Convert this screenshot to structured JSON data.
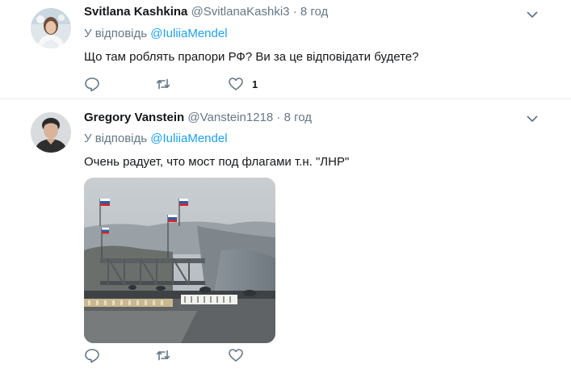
{
  "tweets": [
    {
      "fullname": "Svitlana Kashkina",
      "handle": "@SvitlanaKashki3",
      "separator": "·",
      "time": "8 год",
      "reply_prefix": "У відповідь",
      "reply_mention": "@IuliiaMendel",
      "text": "Що там роблять прапори РФ? Ви за це відповідати будете?",
      "like_count": "1",
      "icons": [
        "reply-icon",
        "retweet-icon",
        "heart-icon",
        "chevron-down-icon"
      ]
    },
    {
      "fullname": "Gregory Vanstein",
      "handle": "@Vanstein1218",
      "separator": "·",
      "time": "8 год",
      "reply_prefix": "У відповідь",
      "reply_mention": "@IuliiaMendel",
      "text": "Очень радует, что мост под флагами т.н. \"ЛНР\"",
      "like_count": "",
      "icons": [
        "reply-icon",
        "retweet-icon",
        "heart-icon",
        "chevron-down-icon"
      ]
    }
  ],
  "colors": {
    "link": "#1da1f2",
    "secondary_text": "#657786",
    "primary_text": "#14171a",
    "separator": "#e6ecf0"
  }
}
